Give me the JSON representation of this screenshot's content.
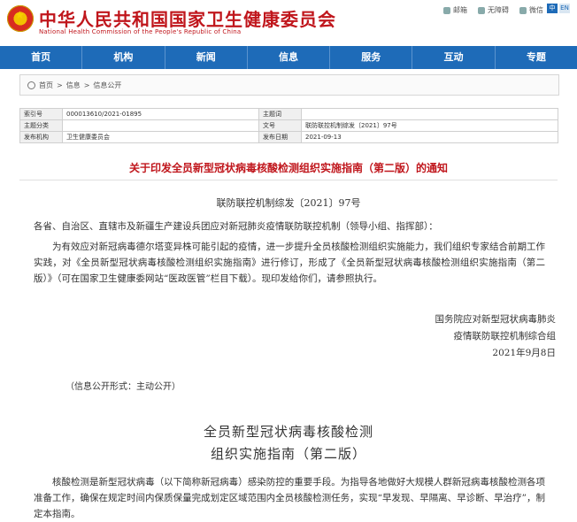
{
  "header": {
    "title": "中华人民共和国国家卫生健康委员会",
    "subtitle": "National Health Commission of the People's Republic of China",
    "links": [
      "邮箱",
      "无障碍",
      "微信"
    ],
    "lang": [
      "中",
      "EN"
    ]
  },
  "nav": [
    "首页",
    "机构",
    "新闻",
    "信息",
    "服务",
    "互动",
    "专题"
  ],
  "breadcrumb": [
    "首页",
    "信息",
    "信息公开"
  ],
  "meta": {
    "index_label": "索引号",
    "index_value": "000013610/2021-01895",
    "topic_label": "主题词",
    "topic_value": "",
    "category_label": "主题分类",
    "category_value": "",
    "docno_label": "文号",
    "docno_value": "联防联控机制综发〔2021〕97号",
    "org_label": "发布机构",
    "org_value": "卫生健康委员会",
    "date_label": "发布日期",
    "date_value": "2021-09-13"
  },
  "document": {
    "title": "关于印发全员新型冠状病毒核酸检测组织实施指南（第二版）的通知",
    "doc_no": "联防联控机制综发〔2021〕97号",
    "salutation": "各省、自治区、直辖市及新疆生产建设兵团应对新冠肺炎疫情联防联控机制（领导小组、指挥部）：",
    "paragraph": "为有效应对新冠病毒德尔塔变异株可能引起的疫情，进一步提升全员核酸检测组织实施能力，我们组织专家结合前期工作实践，对《全员新型冠状病毒核酸检测组织实施指南》进行修订，形成了《全员新型冠状病毒核酸检测组织实施指南（第二版）》（可在国家卫生健康委网站“医政医管”栏目下载）。现印发给你们，请参照执行。",
    "signature_line1": "国务院应对新型冠状病毒肺炎",
    "signature_line2": "疫情联防联控机制综合组",
    "signature_date": "2021年9月8日",
    "disclosure": "（信息公开形式：主动公开）",
    "guide_title_line1": "全员新型冠状病毒核酸检测",
    "guide_title_line2": "组织实施指南（第二版）",
    "guide_paragraph": "核酸检测是新型冠状病毒（以下简称新冠病毒）感染防控的重要手段。为指导各地做好大规模人群新冠病毒核酸检测各项准备工作，确保在规定时间内保质保量完成划定区域范围内全员核酸检测任务，实现“早发现、早隔离、早诊断、早治疗”，制定本指南。"
  },
  "colors": {
    "brand_red": "#c0161c",
    "nav_blue": "#1e6bb8"
  }
}
